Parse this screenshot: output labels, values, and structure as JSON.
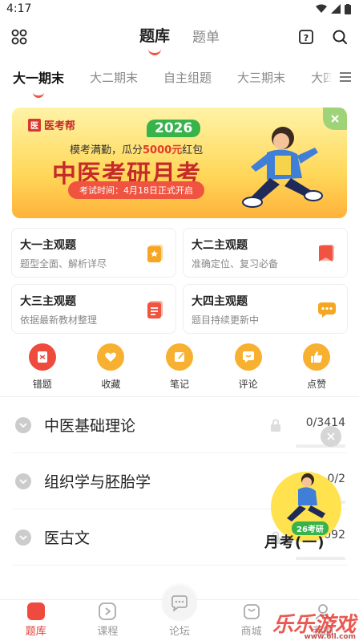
{
  "status": {
    "time": "4:17"
  },
  "topnav": {
    "tabs": [
      "题库",
      "题单"
    ]
  },
  "subtabs": [
    "大一期末",
    "大二期末",
    "自主组题",
    "大三期末",
    "大四期末"
  ],
  "banner": {
    "logo": "医考帮",
    "logo_mark": "医",
    "year": "2026",
    "sub_prefix": "模考满勤，瓜分",
    "sub_amount": "5000元",
    "sub_suffix": "红包",
    "title": "中医考研月考",
    "time": "考试时间：4月18日正式开启"
  },
  "cards": [
    {
      "title": "大一主观题",
      "desc": "题型全面、解析详尽",
      "icon": "star-doc-icon",
      "color": "#f5a623"
    },
    {
      "title": "大二主观题",
      "desc": "准确定位、复习必备",
      "icon": "bookmark-icon",
      "color": "#f0533f"
    },
    {
      "title": "大三主观题",
      "desc": "依据最新教材整理",
      "icon": "doc-lines-icon",
      "color": "#f0533f"
    },
    {
      "title": "大四主观题",
      "desc": "题目持续更新中",
      "icon": "chat-icon",
      "color": "#f5a623"
    }
  ],
  "tools": [
    {
      "label": "错题",
      "icon": "wrong-book-icon",
      "color": "#ee4b3e"
    },
    {
      "label": "收藏",
      "icon": "heart-icon",
      "color": "#f7b030"
    },
    {
      "label": "笔记",
      "icon": "note-icon",
      "color": "#f7b030"
    },
    {
      "label": "评论",
      "icon": "comment-icon",
      "color": "#f7b030"
    },
    {
      "label": "点赞",
      "icon": "thumb-up-icon",
      "color": "#f7b030"
    }
  ],
  "subjects": [
    {
      "name": "中医基础理论",
      "count": "0/3414"
    },
    {
      "name": "组织学与胚胎学",
      "count": "0/2"
    },
    {
      "name": "医古文",
      "count": "0/1092"
    }
  ],
  "float_ad": {
    "label": "26考研",
    "big": "月考(一)"
  },
  "bottombar": [
    "题库",
    "课程",
    "论坛",
    "商城",
    "我的"
  ],
  "watermark": {
    "big": "乐乐游戏",
    "small": "www.6ll.com"
  },
  "colors": {
    "accent": "#f0533f"
  }
}
